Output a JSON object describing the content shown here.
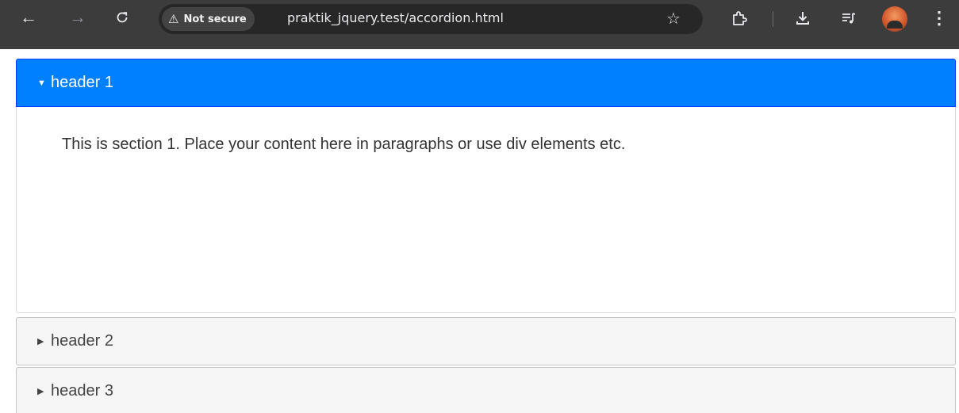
{
  "browser": {
    "back_icon": "←",
    "forward_icon": "→",
    "reload_icon": "C",
    "security_warning_icon": "⚠",
    "security_label": "Not secure",
    "url": "praktik_jquery.test/accordion.html",
    "star_icon": "☆",
    "menu_icon": "⋮"
  },
  "accordion": {
    "sections": [
      {
        "header": "header 1",
        "expanded_caret": "▼",
        "content": "This is section 1. Place your content here in paragraphs or use div elements etc."
      },
      {
        "header": "header 2",
        "collapsed_caret": "▶"
      },
      {
        "header": "header 3",
        "collapsed_caret": "▶"
      }
    ]
  },
  "colors": {
    "active_header": "#007fff",
    "inactive_header": "#f6f6f6",
    "toolbar": "#3c3c3c"
  }
}
